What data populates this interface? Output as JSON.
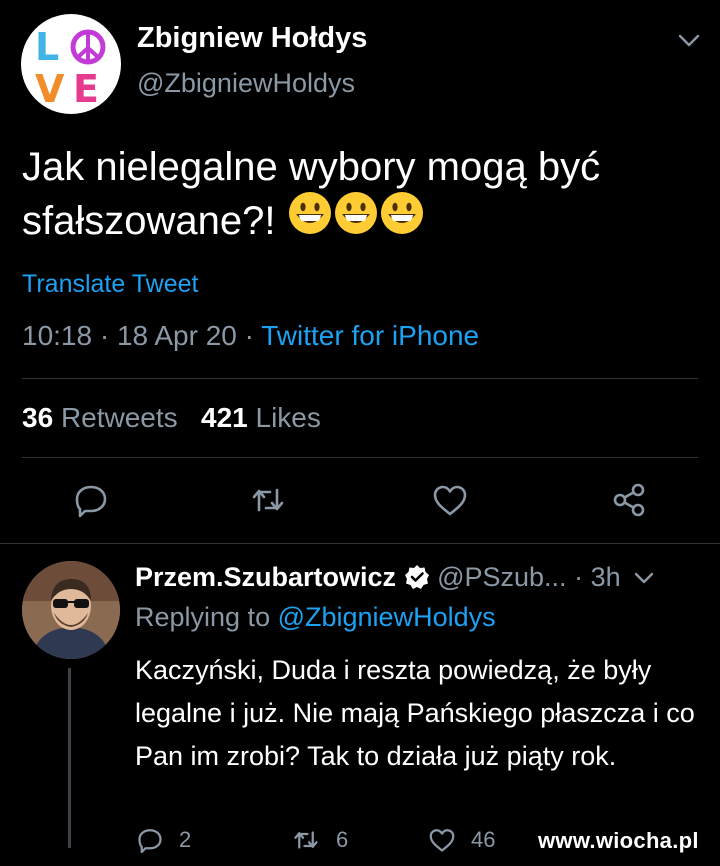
{
  "tweet": {
    "author_name": "Zbigniew Hołdys",
    "author_handle": "@ZbigniewHoldys",
    "avatar_text": "LOVE",
    "text": "Jak nielegalne wybory mogą być sfałszowane?!",
    "emojis": [
      "grinning-face",
      "grinning-face",
      "grinning-face"
    ],
    "translate_label": "Translate Tweet",
    "time": "10:18",
    "date": "18 Apr 20",
    "separator": "·",
    "source": "Twitter for iPhone",
    "retweets_count": "36",
    "retweets_label": "Retweets",
    "likes_count": "421",
    "likes_label": "Likes",
    "actions": [
      "reply-icon",
      "retweet-icon",
      "like-icon",
      "share-icon"
    ]
  },
  "reply": {
    "author_name": "Przem.Szubartowicz",
    "verified": true,
    "author_handle": "@PSzub...",
    "age": "· 3h",
    "replying_label": "Replying to",
    "replying_handle": "@ZbigniewHoldys",
    "text": "Kaczyński, Duda i reszta powiedzą, że były legalne i już. Nie mają Pańskiego płaszcza i co Pan im zrobi? Tak to działa już piąty rok.",
    "reply_count": "2",
    "retweet_count": "6",
    "like_count": "46"
  },
  "watermark": {
    "prefix": "www.",
    "name": "wiocha",
    "suffix": ".pl"
  },
  "colors": {
    "background": "#000000",
    "text": "#ffffff",
    "muted": "#8b98a5",
    "link": "#1da1f2",
    "divider": "#2f3336",
    "emoji": "#ffcc33"
  }
}
